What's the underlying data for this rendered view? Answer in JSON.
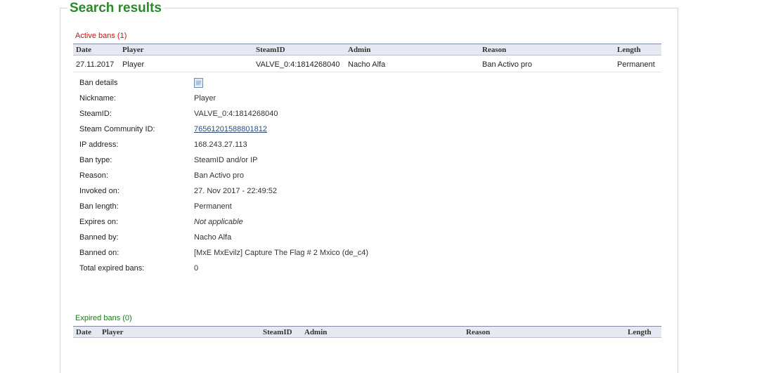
{
  "page_title": "Search results",
  "active_bans": {
    "title": "Active bans (1)",
    "headers": {
      "date": "Date",
      "player": "Player",
      "steamid": "SteamID",
      "admin": "Admin",
      "reason": "Reason",
      "length": "Length"
    },
    "rows": [
      {
        "date": "27.11.2017",
        "player": "Player",
        "steamid": "VALVE_0:4:1814268040",
        "admin": "Nacho Alfa",
        "reason": "Ban Activo pro",
        "length": "Permanent"
      }
    ]
  },
  "ban_details": {
    "header_label": "Ban details",
    "icon": "document-icon",
    "fields": [
      {
        "label": "Nickname:",
        "value": "Player"
      },
      {
        "label": "SteamID:",
        "value": "VALVE_0:4:1814268040"
      },
      {
        "label": "Steam Community ID:",
        "value": "76561201588801812",
        "is_link": true
      },
      {
        "label": "IP address:",
        "value": "168.243.27.113"
      },
      {
        "label": "Ban type:",
        "value": "SteamID and/or IP"
      },
      {
        "label": "Reason:",
        "value": "Ban Activo pro"
      },
      {
        "label": "Invoked on:",
        "value": "27. Nov 2017 - 22:49:52"
      },
      {
        "label": "Ban length:",
        "value": "Permanent"
      },
      {
        "label": "Expires on:",
        "value": "Not applicable",
        "italic": true
      },
      {
        "label": "Banned by:",
        "value": "Nacho Alfa"
      },
      {
        "label": "Banned on:",
        "value": "[MxE MxEvilz] Capture The Flag # 2 Mxico (de_c4)"
      },
      {
        "label": "Total expired bans:",
        "value": "0"
      }
    ]
  },
  "expired_bans": {
    "title": "Expired bans (0)",
    "headers": {
      "date": "Date",
      "player": "Player",
      "steamid": "SteamID",
      "admin": "Admin",
      "reason": "Reason",
      "length": "Length"
    }
  },
  "colors": {
    "title_green": "#2a8a2a",
    "active_red": "#cc1111",
    "expired_green": "#1a7a1a",
    "header_bg": "#e6e9f2",
    "link": "#2c4c77"
  }
}
